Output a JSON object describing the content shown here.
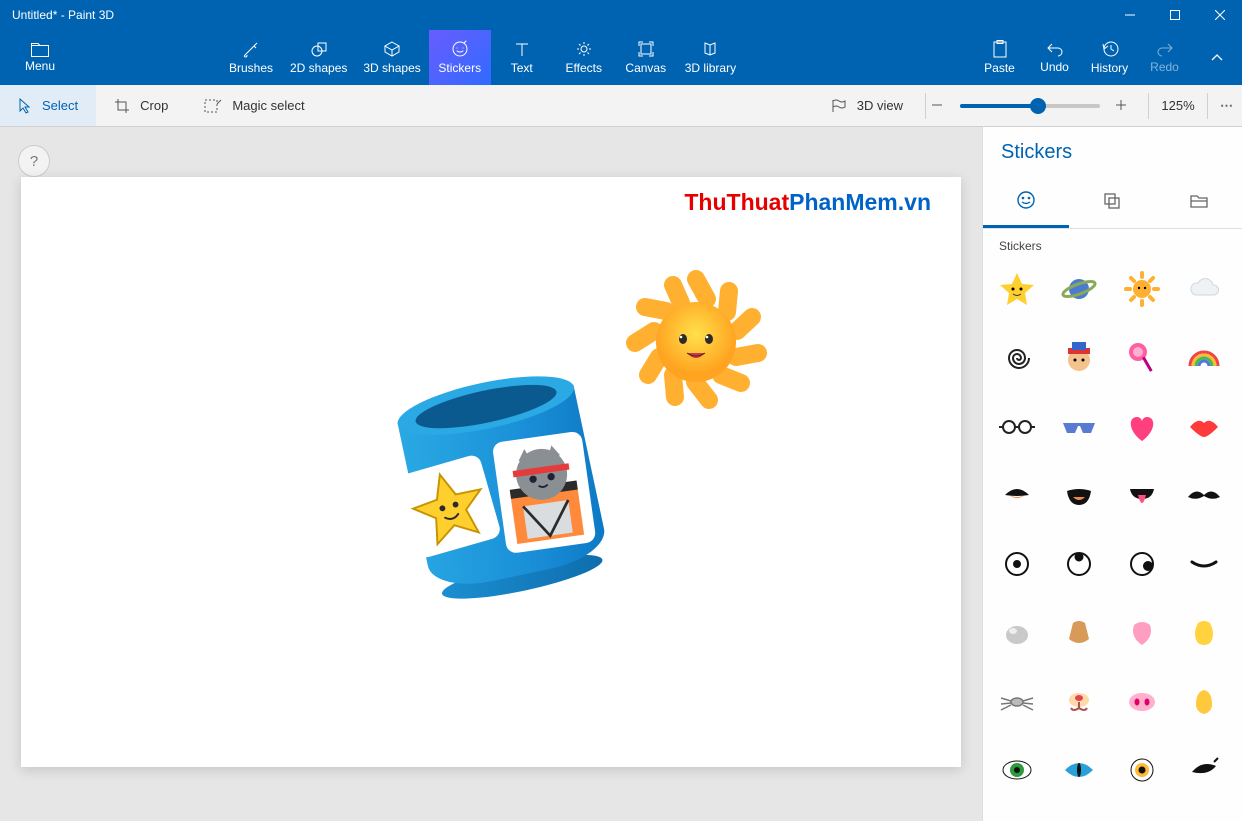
{
  "window": {
    "title": "Untitled* - Paint 3D"
  },
  "menu": {
    "label": "Menu"
  },
  "ribbon": {
    "tabs": [
      {
        "label": "Brushes"
      },
      {
        "label": "2D shapes"
      },
      {
        "label": "3D shapes"
      },
      {
        "label": "Stickers"
      },
      {
        "label": "Text"
      },
      {
        "label": "Effects"
      },
      {
        "label": "Canvas"
      },
      {
        "label": "3D library"
      }
    ],
    "right": {
      "paste": "Paste",
      "undo": "Undo",
      "history": "History",
      "redo": "Redo"
    }
  },
  "options": {
    "select": "Select",
    "crop": "Crop",
    "magic": "Magic select",
    "view3d": "3D view",
    "zoom_pct": "125%"
  },
  "sidepanel": {
    "title": "Stickers",
    "tab_labels": {
      "stickers": "Stickers",
      "textures": "Textures",
      "custom": "Custom"
    },
    "section": "Stickers",
    "items": [
      "star-smile",
      "planet",
      "sun-smile",
      "cloud",
      "spiral",
      "face-hat",
      "lollipop",
      "rainbow",
      "glasses",
      "sunglasses",
      "heart",
      "lips",
      "mouth-a",
      "mouth-open",
      "tongue",
      "mustache",
      "eye-dot",
      "eye-look-up",
      "eye-look-side",
      "lash",
      "nose-round",
      "nose-dog",
      "nose-pink",
      "nose-yellow",
      "whiskers",
      "snout",
      "pig-nose",
      "nose-bell",
      "eye-green",
      "eye-cat",
      "eye-brown",
      "eye-wink"
    ]
  },
  "watermark": {
    "part1": "ThuThuat",
    "part2": "PhanMem.vn"
  },
  "help": "?"
}
